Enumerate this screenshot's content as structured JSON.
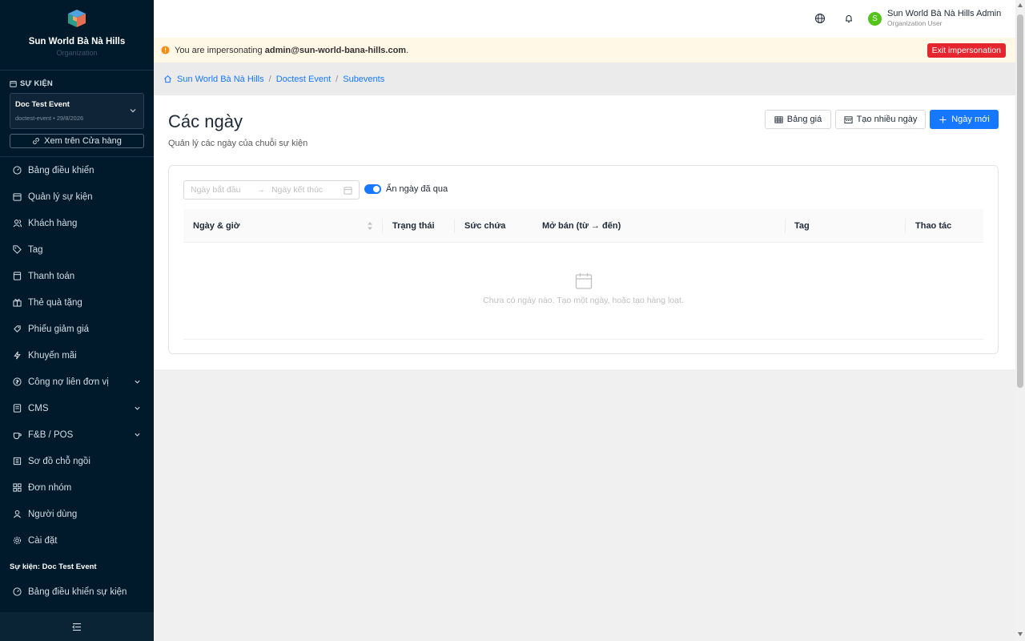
{
  "brand": {
    "name": "Sun World Bà Nà Hills",
    "subtitle": "Organization"
  },
  "sidebar": {
    "section_label": "SỰ KIỆN",
    "event": {
      "name": "Doc Test Event",
      "meta": "doctest-event • 29/8/2026"
    },
    "store_button": "Xem trên Cửa hàng",
    "items": [
      {
        "label": "Bảng điều khiển",
        "icon": "dashboard-icon"
      },
      {
        "label": "Quản lý sự kiện",
        "icon": "calendar-icon"
      },
      {
        "label": "Khách hàng",
        "icon": "users-icon"
      },
      {
        "label": "Tag",
        "icon": "tag-icon"
      },
      {
        "label": "Thanh toán",
        "icon": "payment-icon"
      },
      {
        "label": "Thẻ quà tặng",
        "icon": "gift-icon"
      },
      {
        "label": "Phiếu giảm giá",
        "icon": "coupon-icon"
      },
      {
        "label": "Khuyến mãi",
        "icon": "lightning-icon"
      },
      {
        "label": "Công nợ liên đơn vị",
        "icon": "debt-icon",
        "expandable": true
      },
      {
        "label": "CMS",
        "icon": "cms-icon",
        "expandable": true
      },
      {
        "label": "F&B / POS",
        "icon": "coffee-icon",
        "expandable": true
      },
      {
        "label": "Sơ đồ chỗ ngồi",
        "icon": "seat-map-icon"
      },
      {
        "label": "Đơn nhóm",
        "icon": "group-order-icon"
      },
      {
        "label": "Người dùng",
        "icon": "user-icon"
      },
      {
        "label": "Cài đặt",
        "icon": "settings-icon"
      }
    ],
    "event_section_heading": "Sự kiện: Doc Test Event",
    "event_items": [
      {
        "label": "Bảng điều khiển sự kiện",
        "icon": "dashboard-icon"
      }
    ]
  },
  "header": {
    "user_name": "Sun World Bà Nà Hills Admin",
    "user_role": "Organization User",
    "avatar_initial": "S"
  },
  "banner": {
    "prefix": "You are impersonating ",
    "email": "admin@sun-world-bana-hills.com",
    "suffix": ".",
    "exit_label": "Exit impersonation"
  },
  "breadcrumb": [
    "Sun World Bà Nà Hills",
    "Doctest Event",
    "Subevents"
  ],
  "page": {
    "title": "Các ngày",
    "subtitle": "Quản lý các ngày của chuỗi sự kiện",
    "buttons": {
      "price_table": "Bảng giá",
      "bulk_create": "Tạo nhiều ngày",
      "new_day": "Ngày mới"
    }
  },
  "filters": {
    "start_placeholder": "Ngày bắt đầu",
    "end_placeholder": "Ngày kết thúc",
    "hide_past_label": "Ẩn ngày đã qua",
    "hide_past_enabled": true
  },
  "table": {
    "columns": [
      "Ngày & giờ",
      "Trạng thái",
      "Sức chứa",
      "Mở bán (từ → đến)",
      "Tag",
      "Thao tác"
    ],
    "empty_text": "Chưa có ngày nào. Tạo một ngày, hoặc tạo hàng loạt."
  },
  "colors": {
    "sidebar_bg": "#001a2c",
    "primary": "#1677ff",
    "danger": "#e5262e",
    "banner_bg": "#fff8e6",
    "avatar": "#52c41a"
  }
}
